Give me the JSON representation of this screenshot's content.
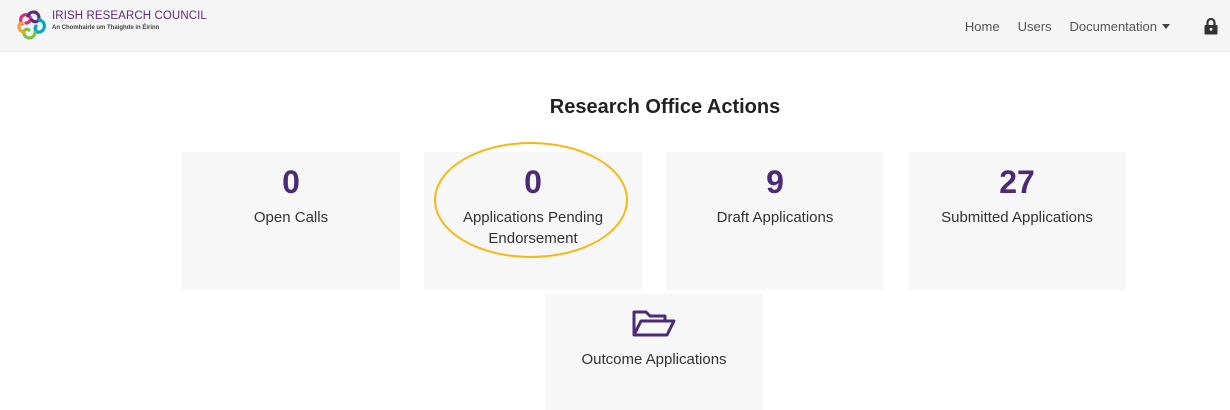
{
  "header": {
    "brand_name": "IRISH RESEARCH COUNCIL",
    "brand_subtitle": "An Chomhairle um Thaighde in Éirinn",
    "nav": {
      "home": "Home",
      "users": "Users",
      "documentation": "Documentation"
    },
    "icons": {
      "logo": "irish-research-council-logo",
      "dropdown": "caret-down-icon",
      "account": "lock-icon"
    }
  },
  "main": {
    "title": "Research Office Actions",
    "cards": [
      {
        "count": "0",
        "label": "Open Calls"
      },
      {
        "count": "0",
        "label": "Applications Pending Endorsement"
      },
      {
        "count": "9",
        "label": "Draft Applications"
      },
      {
        "count": "27",
        "label": "Submitted Applications"
      },
      {
        "icon": "folder-open-icon",
        "label": "Outcome Applications"
      }
    ]
  },
  "colors": {
    "accent_purple": "#4b2a78",
    "highlight_ring": "#f5b914",
    "card_background": "#f7f7f7",
    "navbar_background": "#f5f5f5"
  }
}
